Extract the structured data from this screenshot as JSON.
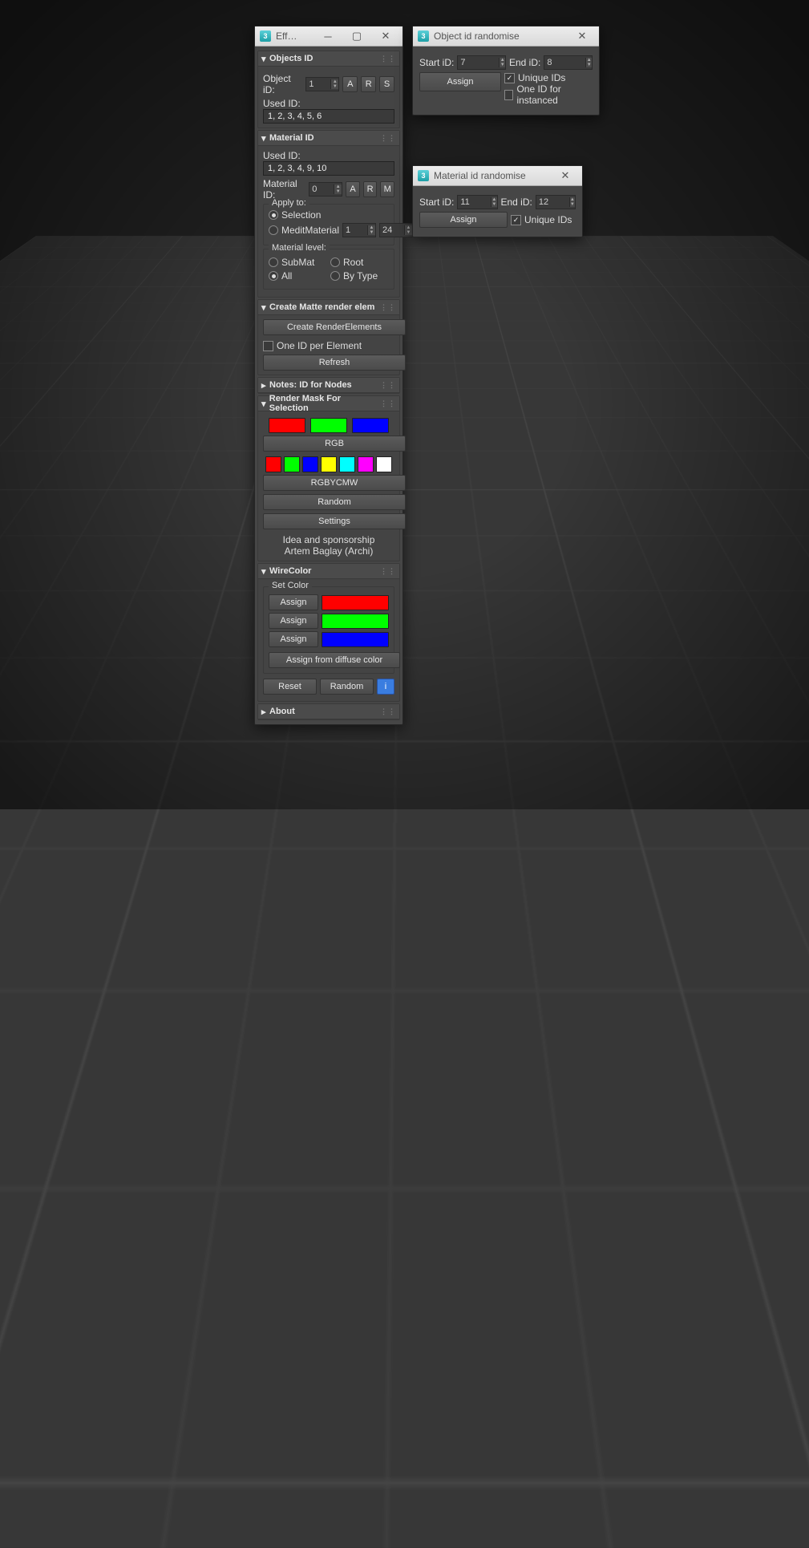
{
  "viewport": {},
  "mainWin": {
    "title": "Eff…",
    "objectsId": {
      "header": "Objects ID",
      "label": "Object iD:",
      "value": "1",
      "btnA": "A",
      "btnR": "R",
      "btnS": "S",
      "usedLabel": "Used ID:",
      "usedValue": "1, 2, 3, 4, 5, 6"
    },
    "materialId": {
      "header": "Material ID",
      "usedLabel": "Used ID:",
      "usedValue": "1, 2, 3, 4, 9, 10",
      "label": "Material ID:",
      "value": "0",
      "btnA": "A",
      "btnR": "R",
      "btnM": "M",
      "applyTo": {
        "title": "Apply to:",
        "selection": "Selection",
        "medit": "MeditMaterial",
        "meditStart": "1",
        "meditEnd": "24",
        "selected": "selection"
      },
      "level": {
        "title": "Material level:",
        "submat": "SubMat",
        "root": "Root",
        "all": "All",
        "bytype": "By Type",
        "selected": "all"
      }
    },
    "matte": {
      "header": "Create Matte render elem",
      "create": "Create RenderElements",
      "oneId": "One ID per Element",
      "refresh": "Refresh"
    },
    "notes": {
      "header": "Notes: ID for Nodes"
    },
    "mask": {
      "header": "Render Mask For Selection",
      "rgb": "RGB",
      "rgbycmw": "RGBYCMW",
      "random": "Random",
      "settings": "Settings",
      "idea": "Idea and sponsorship",
      "credit": "Artem Baglay (Archi)",
      "colors3": [
        "#ff0000",
        "#00ff00",
        "#0000ff"
      ],
      "colors7": [
        "#ff0000",
        "#00ff00",
        "#0000ff",
        "#ffff00",
        "#00ffff",
        "#ff00ff",
        "#ffffff"
      ]
    },
    "wire": {
      "header": "WireColor",
      "setColor": "Set Color",
      "assign": "Assign",
      "colors": [
        "#ff0000",
        "#00ff00",
        "#0000ff"
      ],
      "fromDiffuse": "Assign from diffuse color",
      "reset": "Reset",
      "random": "Random",
      "info": "i"
    },
    "about": {
      "header": "About"
    }
  },
  "objRandWin": {
    "title": "Object id randomise",
    "startLabel": "Start iD:",
    "startVal": "7",
    "endLabel": "End iD:",
    "endVal": "8",
    "assign": "Assign",
    "unique": "Unique IDs",
    "uniqueChecked": true,
    "instanced": "One ID for instanced",
    "instancedChecked": false
  },
  "matRandWin": {
    "title": "Material id randomise",
    "startLabel": "Start iD:",
    "startVal": "11",
    "endLabel": "End iD:",
    "endVal": "12",
    "assign": "Assign",
    "unique": "Unique IDs",
    "uniqueChecked": true
  }
}
